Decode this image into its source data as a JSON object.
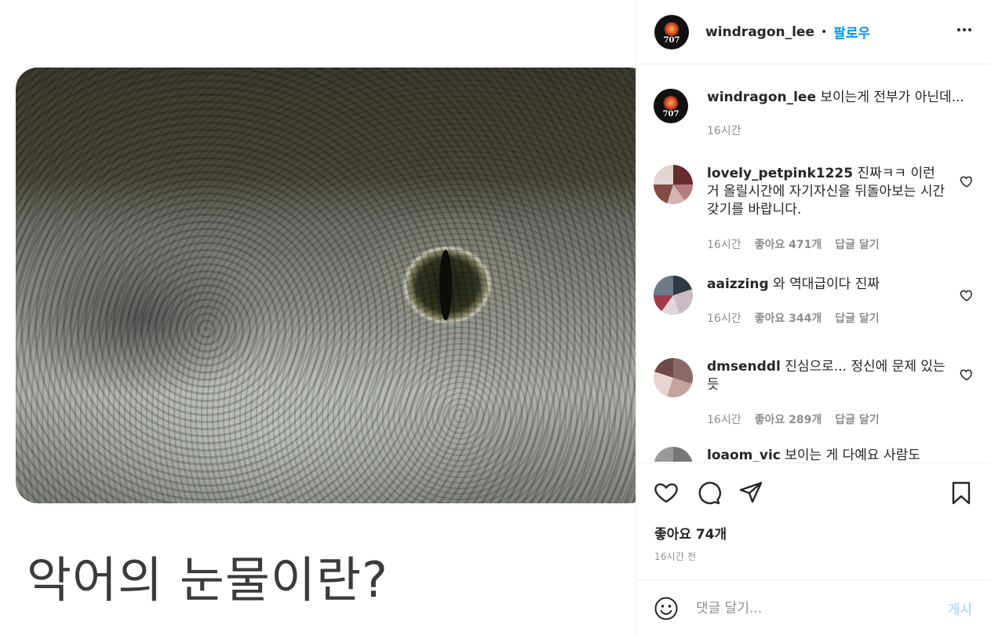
{
  "media": {
    "caption": "악어의 눈물이란?"
  },
  "header": {
    "username": "windragon_lee",
    "separator": "•",
    "follow_label": "팔로우",
    "more_label": "•••",
    "avatar_text": "707"
  },
  "caption_comment": {
    "username": "windragon_lee",
    "text": "보이는게 전부가 아닌데...",
    "time": "16시간",
    "avatar_text": "707"
  },
  "comments": [
    {
      "username": "lovely_petpink1225",
      "text": "진짜ㅋㅋ 이런 거 올릴시간에 자기자신을 뒤돌아보는 시간 갖기를 바랍니다.",
      "time": "16시간",
      "likes": "좋아요 471개",
      "reply": "답글 달기"
    },
    {
      "username": "aaizzing",
      "text": "와 역대급이다 진짜",
      "time": "16시간",
      "likes": "좋아요 344개",
      "reply": "답글 달기"
    },
    {
      "username": "dmsenddl",
      "text": "진심으로... 정신에 문제 있는듯",
      "time": "16시간",
      "likes": "좋아요 289개",
      "reply": "답글 달기"
    },
    {
      "username": "loaom_vic",
      "text": "보이는 게 다예요 사람도"
    }
  ],
  "footer": {
    "likes": "좋아요 74개",
    "time": "16시간 전",
    "comment_placeholder": "댓글 달기...",
    "post_label": "게시"
  },
  "colors": {
    "accent": "#0095f6",
    "post_disabled": "#b2dffc",
    "muted_text": "#8e8e8e",
    "border": "#efefef"
  },
  "icons": [
    "heart-icon",
    "comment-icon",
    "share-icon",
    "bookmark-icon",
    "emoji-icon",
    "more-icon"
  ]
}
